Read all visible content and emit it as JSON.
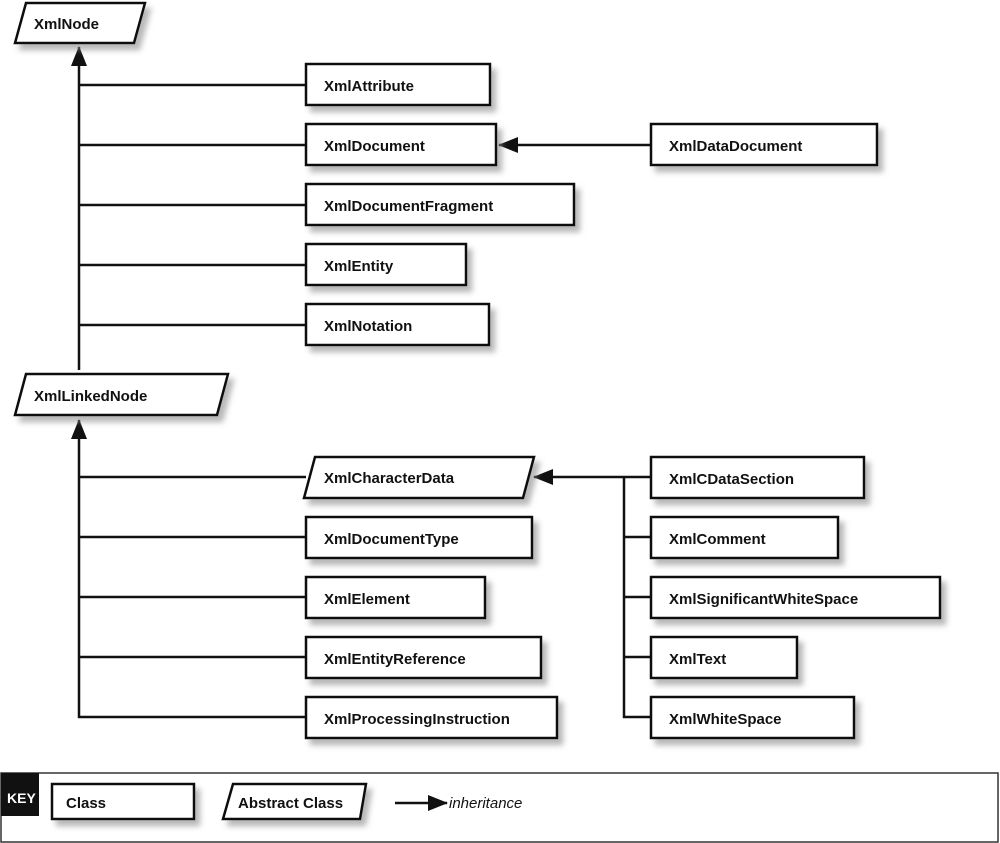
{
  "nodes": {
    "xmlnode": "XmlNode",
    "xmlattribute": "XmlAttribute",
    "xmldocument": "XmlDocument",
    "xmldatadocument": "XmlDataDocument",
    "xmldocumentfragment": "XmlDocumentFragment",
    "xmlentity": "XmlEntity",
    "xmlnotation": "XmlNotation",
    "xmllinkednode": "XmlLinkedNode",
    "xmlcharacterdata": "XmlCharacterData",
    "xmldocumenttype": "XmlDocumentType",
    "xmlelement": "XmlElement",
    "xmlentityreference": "XmlEntityReference",
    "xmlprocessinginstruction": "XmlProcessingInstruction",
    "xmlcdatasection": "XmlCDataSection",
    "xmlcomment": "XmlComment",
    "xmlsignificantwhitespace": "XmlSignificantWhiteSpace",
    "xmltext": "XmlText",
    "xmlwhitespace": "XmlWhiteSpace"
  },
  "key": {
    "title": "KEY",
    "class": "Class",
    "abstract_class": "Abstract Class",
    "inheritance": "inheritance"
  }
}
